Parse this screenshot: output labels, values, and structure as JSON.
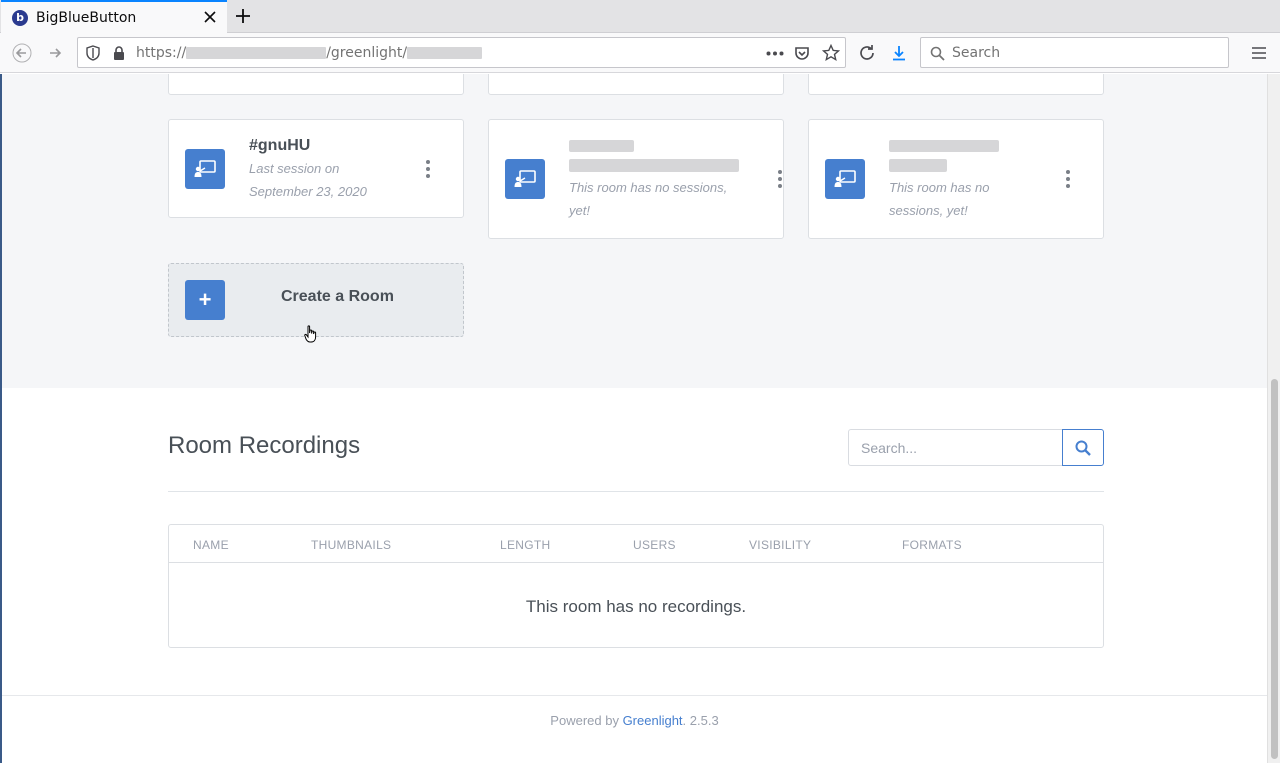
{
  "browser": {
    "tab_title": "BigBlueButton",
    "url_prefix": "https://",
    "url_path": "/greenlight/",
    "search_placeholder": "Search",
    "accent": "#0a84ff"
  },
  "rooms": {
    "cards": [
      {
        "title": "#gnuHU",
        "subtitle": "Last session on September 23, 2020",
        "icon": "presentation-icon"
      },
      {
        "title": "",
        "subtitle": "This room has no sessions, yet!",
        "icon": "presentation-icon"
      },
      {
        "title": "",
        "subtitle": "This room has no sessions, yet!",
        "icon": "presentation-icon"
      }
    ],
    "create_label": "Create a Room",
    "brand_color": "#467fcf"
  },
  "recordings": {
    "title": "Room Recordings",
    "search_placeholder": "Search...",
    "columns": [
      "NAME",
      "THUMBNAILS",
      "LENGTH",
      "USERS",
      "VISIBILITY",
      "FORMATS"
    ],
    "empty_message": "This room has no recordings."
  },
  "footer": {
    "prefix": "Powered by ",
    "link": "Greenlight",
    "version": ". 2.5.3"
  }
}
